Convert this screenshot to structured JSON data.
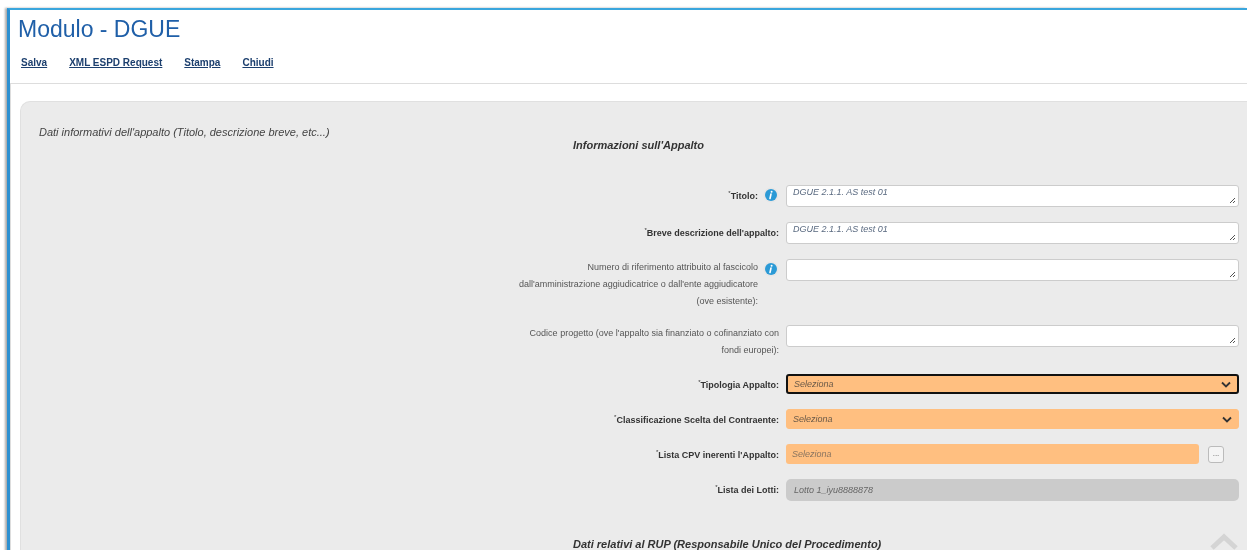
{
  "window": {
    "title": "Modulo - DGUE"
  },
  "toolbar": [
    "Salva",
    "XML ESPD Request",
    "Stampa",
    "Chiudi"
  ],
  "panel": {
    "caption": "Dati informativi dell'appalto (Titolo, descrizione breve, etc...)",
    "section_title": "Informazioni sull'Appalto",
    "fields": [
      {
        "kind": "textarea",
        "label": "$^{*}$Titolo:",
        "required": true,
        "info": true,
        "value": "DGUE 2.1.1. AS test 01"
      },
      {
        "kind": "textarea",
        "label": "$^{*}$Breve descrizione dell'appalto:",
        "required": true,
        "info": false,
        "value": "DGUE 2.1.1. AS test 01"
      },
      {
        "kind": "textarea",
        "label": "Numero di riferimento attribuito al fascicolo dall'amministrazione aggiudicatrice o dall'ente aggiudicatore (ove esistente):",
        "required": false,
        "info": true
      },
      {
        "kind": "textarea",
        "label": "Codice progetto (ove l'appalto sia finanziato o cofinanziato con fondi europei):",
        "required": false,
        "info": false
      },
      {
        "kind": "select",
        "label": "$^{*}$Tipologia Appalto:",
        "required": true,
        "info": false,
        "focused": true,
        "placeholder": "Seleziona"
      },
      {
        "kind": "select",
        "label": "$^{*}$Classificazione Scelta del Contraente:",
        "required": true,
        "info": false,
        "focused": false,
        "placeholder": "Seleziona"
      },
      {
        "kind": "lookup",
        "label": "$^{*}$Lista CPV inerenti l'Appalto:",
        "required": true,
        "info": false,
        "placeholder": "Seleziona",
        "button": "..."
      },
      {
        "kind": "readonly",
        "label": "$^{*}$Lista dei Lotti:",
        "required": true,
        "info": false,
        "value": "Lotto 1_iyu8888878"
      }
    ],
    "next_section_title": "Dati relativi al RUP (Responsabile Unico del Procedimento)"
  }
}
